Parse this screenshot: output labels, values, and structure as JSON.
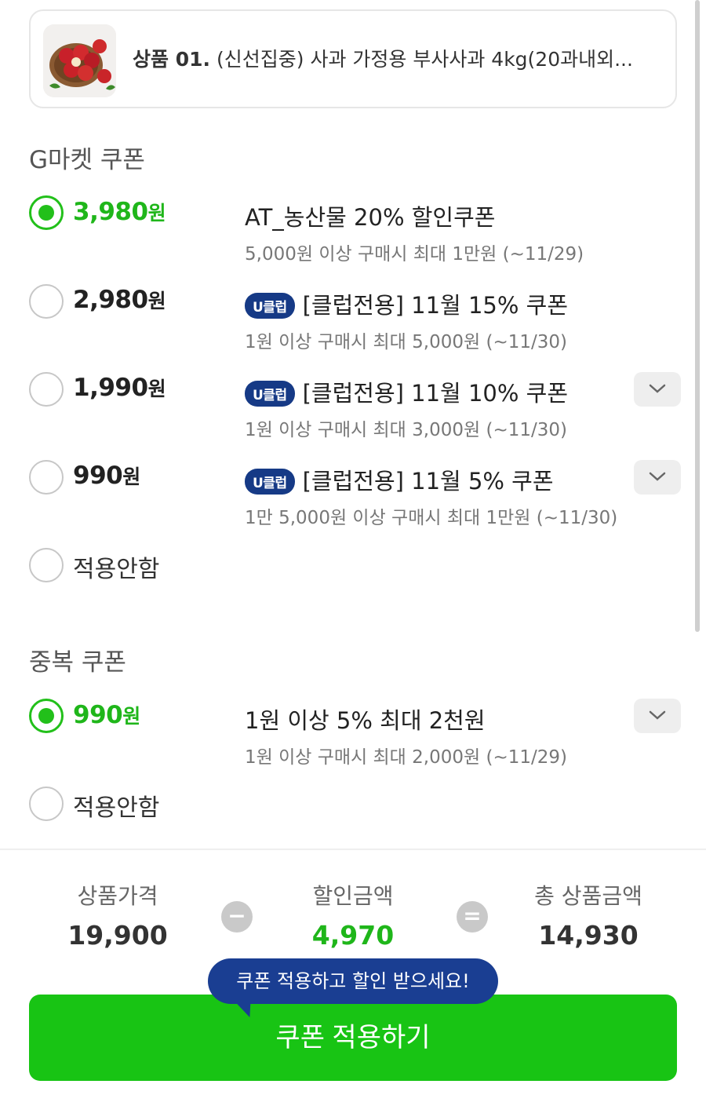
{
  "product": {
    "label": "상품 01.",
    "title": "(신선집중) 사과 가정용 부사사과 4kg(20과내외..."
  },
  "gmarket_section": {
    "title": "G마켓 쿠폰",
    "coupons": [
      {
        "amount": "3,980",
        "unit": "원",
        "selected": true,
        "club": false,
        "name": "AT_농산물 20% 할인쿠폰",
        "condition": "5,000원 이상 구매시 최대 1만원 (~11/29)",
        "expandable": false
      },
      {
        "amount": "2,980",
        "unit": "원",
        "selected": false,
        "club": true,
        "name": "[클럽전용] 11월 15% 쿠폰",
        "condition": "1원 이상 구매시 최대 5,000원 (~11/30)",
        "expandable": false
      },
      {
        "amount": "1,990",
        "unit": "원",
        "selected": false,
        "club": true,
        "name": "[클럽전용] 11월 10% 쿠폰",
        "condition": "1원 이상 구매시 최대 3,000원 (~11/30)",
        "expandable": true
      },
      {
        "amount": "990",
        "unit": "원",
        "selected": false,
        "club": true,
        "name": "[클럽전용] 11월 5% 쿠폰",
        "condition": "1만 5,000원 이상 구매시 최대 1만원 (~11/30)",
        "expandable": true
      }
    ],
    "none_label": "적용안함",
    "club_badge": "U클럽"
  },
  "duplicate_section": {
    "title": "중복 쿠폰",
    "coupons": [
      {
        "amount": "990",
        "unit": "원",
        "selected": true,
        "name": "1원 이상 5% 최대 2천원",
        "condition": "1원 이상 구매시 최대 2,000원 (~11/29)",
        "expandable": true
      }
    ],
    "none_label": "적용안함"
  },
  "summary": {
    "price_label": "상품가격",
    "price_value": "19,900",
    "minus": "−",
    "discount_label": "할인금액",
    "discount_value": "4,970",
    "equals": "=",
    "total_label": "총 상품금액",
    "total_value": "14,930"
  },
  "tooltip": "쿠폰 적용하고 할인 받으세요!",
  "apply_button": "쿠폰 적용하기",
  "colors": {
    "accent_green": "#18c414",
    "club_navy": "#163a86"
  },
  "icons": [
    "apple-product-thumbnail",
    "chevron-down-icon",
    "radio-icon"
  ]
}
